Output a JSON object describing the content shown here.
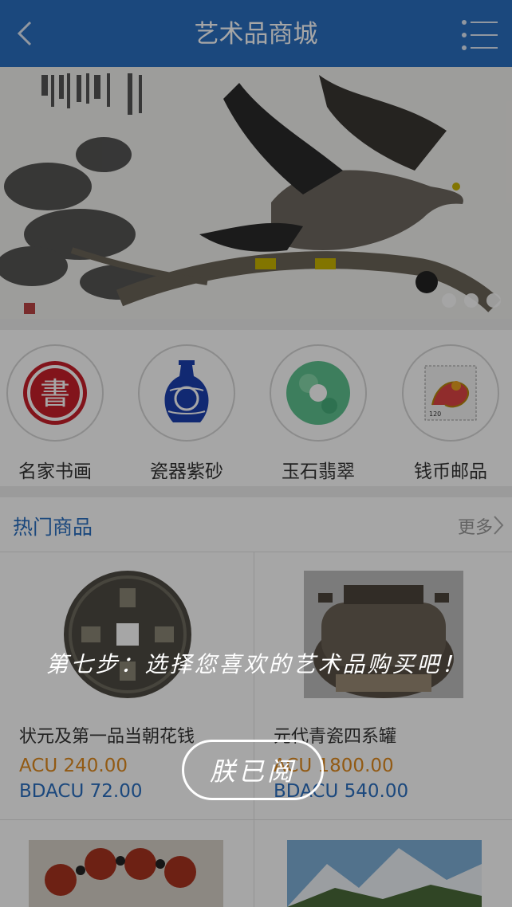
{
  "header": {
    "title": "艺术品商城",
    "back_icon": "back-chevron-icon",
    "menu_icon": "list-menu-icon"
  },
  "banner": {
    "image": "eagle-on-pine-painting",
    "slides": 3
  },
  "categories": [
    {
      "label": "名家书画",
      "icon": "calligraphy-seal-icon"
    },
    {
      "label": "瓷器紫砂",
      "icon": "porcelain-vase-icon"
    },
    {
      "label": "玉石翡翠",
      "icon": "jade-bi-disc-icon"
    },
    {
      "label": "钱币邮品",
      "icon": "dragon-stamp-icon"
    }
  ],
  "hot": {
    "title": "热门商品",
    "more": "更多",
    "items": [
      {
        "name": "状元及第一品当朝花钱",
        "price_acu": "ACU 240.00",
        "price_bdacu": "BDACU 72.00",
        "image": "ancient-coin-image"
      },
      {
        "name": "元代青瓷四系罐",
        "price_acu": "ACU 1800.00",
        "price_bdacu": "BDACU 540.00",
        "image": "celadon-jar-image"
      }
    ]
  },
  "overlay": {
    "guide_text": "第七步：选择您喜欢的艺术品购买吧！",
    "ack_button": "朕已阅"
  },
  "colors": {
    "header_blue": "#2a6fc0",
    "price_orange": "#e08a1e",
    "price_blue": "#2a6fc0"
  }
}
